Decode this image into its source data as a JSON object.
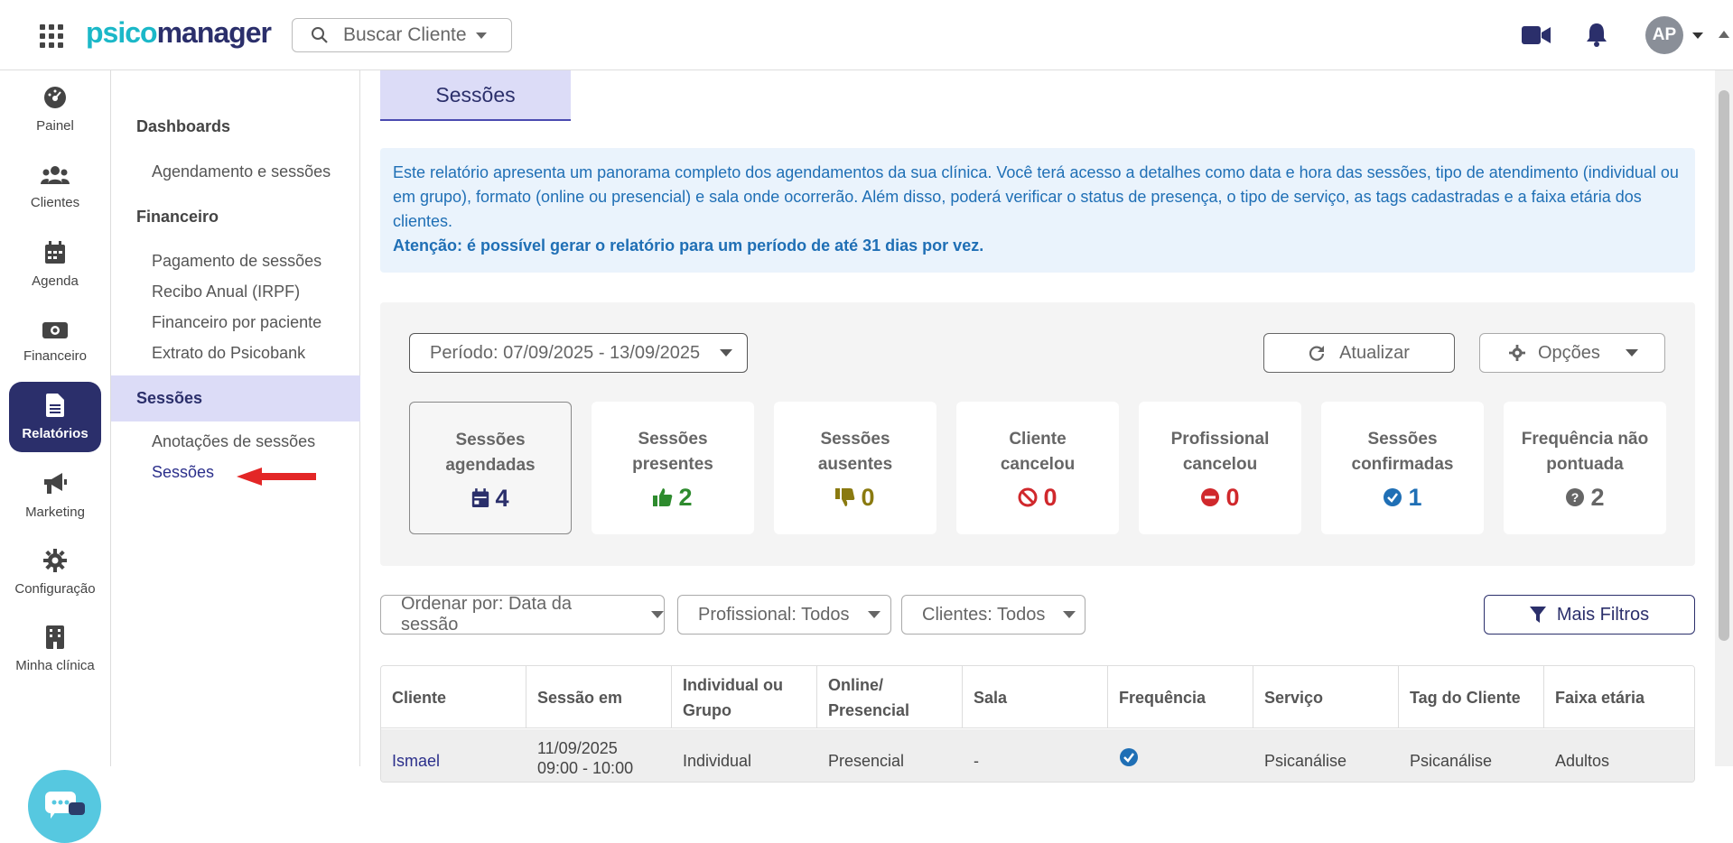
{
  "header": {
    "logo_part1": "psico",
    "logo_part2": "manager",
    "search_placeholder": "Buscar Cliente",
    "avatar_initials": "AP"
  },
  "leftnav": {
    "items": [
      {
        "label": "Painel",
        "icon": "gauge-icon"
      },
      {
        "label": "Clientes",
        "icon": "users-icon"
      },
      {
        "label": "Agenda",
        "icon": "calendar-icon"
      },
      {
        "label": "Financeiro",
        "icon": "money-icon"
      },
      {
        "label": "Relatórios",
        "icon": "report-icon",
        "active": true
      },
      {
        "label": "Marketing",
        "icon": "megaphone-icon"
      },
      {
        "label": "Configuração",
        "icon": "gear-icon"
      },
      {
        "label": "Minha clínica",
        "icon": "building-icon"
      }
    ]
  },
  "subnav": {
    "dashboards": "Dashboards",
    "agendamento": "Agendamento e sessões",
    "financeiro": "Financeiro",
    "pagamento": "Pagamento de sessões",
    "recibo": "Recibo Anual (IRPF)",
    "fin_paciente": "Financeiro por paciente",
    "extrato": "Extrato do Psicobank",
    "sessoes_head": "Sessões",
    "anotacoes": "Anotações de sessões",
    "sessoes": "Sessões"
  },
  "main": {
    "tab_label": "Sessões",
    "info_text": "Este relatório apresenta um panorama completo dos agendamentos da sua clínica. Você terá acesso a detalhes como data e hora das sessões, tipo de atendimento (individual ou em grupo), formato (online ou presencial) e sala onde ocorrerão. Além disso, poderá verificar o status de presença, o tipo de serviço, as tags cadastradas e a faixa etária dos clientes.",
    "info_warning": "Atenção: é possível gerar o relatório para um período de até 31 dias por vez.",
    "period_label": "Período: 07/09/2025 - 13/09/2025",
    "refresh_label": "Atualizar",
    "options_label": "Opções",
    "cards": [
      {
        "line1": "Sessões",
        "line2": "agendadas",
        "value": "4",
        "color": "#2b2f6b",
        "icon": "calendar-check-icon"
      },
      {
        "line1": "Sessões",
        "line2": "presentes",
        "value": "2",
        "color": "#2e8b2e",
        "icon": "thumbs-up-icon"
      },
      {
        "line1": "Sessões",
        "line2": "ausentes",
        "value": "0",
        "color": "#8a7a10",
        "icon": "thumbs-down-icon"
      },
      {
        "line1": "Cliente",
        "line2": "cancelou",
        "value": "0",
        "color": "#d0282c",
        "icon": "ban-icon"
      },
      {
        "line1": "Profissional",
        "line2": "cancelou",
        "value": "0",
        "color": "#d0282c",
        "icon": "minus-circle-icon"
      },
      {
        "line1": "Sessões",
        "line2": "confirmadas",
        "value": "1",
        "color": "#1f6fb5",
        "icon": "check-circle-icon"
      },
      {
        "line1": "Frequência não",
        "line2": "pontuada",
        "value": "2",
        "color": "#666666",
        "icon": "question-circle-icon"
      }
    ],
    "sort_label": "Ordenar por: Data da sessão",
    "professional_label": "Profissional: Todos",
    "clients_label": "Clientes: Todos",
    "more_filters_label": "Mais Filtros",
    "table": {
      "headers": [
        {
          "l1": "Cliente",
          "l2": ""
        },
        {
          "l1": "Sessão em",
          "l2": ""
        },
        {
          "l1": "Individual ou",
          "l2": "Grupo"
        },
        {
          "l1": "Online/",
          "l2": "Presencial"
        },
        {
          "l1": "Sala",
          "l2": ""
        },
        {
          "l1": "Frequência",
          "l2": ""
        },
        {
          "l1": "Serviço",
          "l2": ""
        },
        {
          "l1": "Tag do Cliente",
          "l2": ""
        },
        {
          "l1": "Faixa etária",
          "l2": ""
        }
      ],
      "row": {
        "client": "Ismael",
        "date": "11/09/2025",
        "time": "09:00 - 10:00",
        "type": "Individual",
        "format": "Presencial",
        "room": "-",
        "service": "Psicanálise",
        "tag": "Psicanálise",
        "age": "Adultos"
      }
    }
  }
}
